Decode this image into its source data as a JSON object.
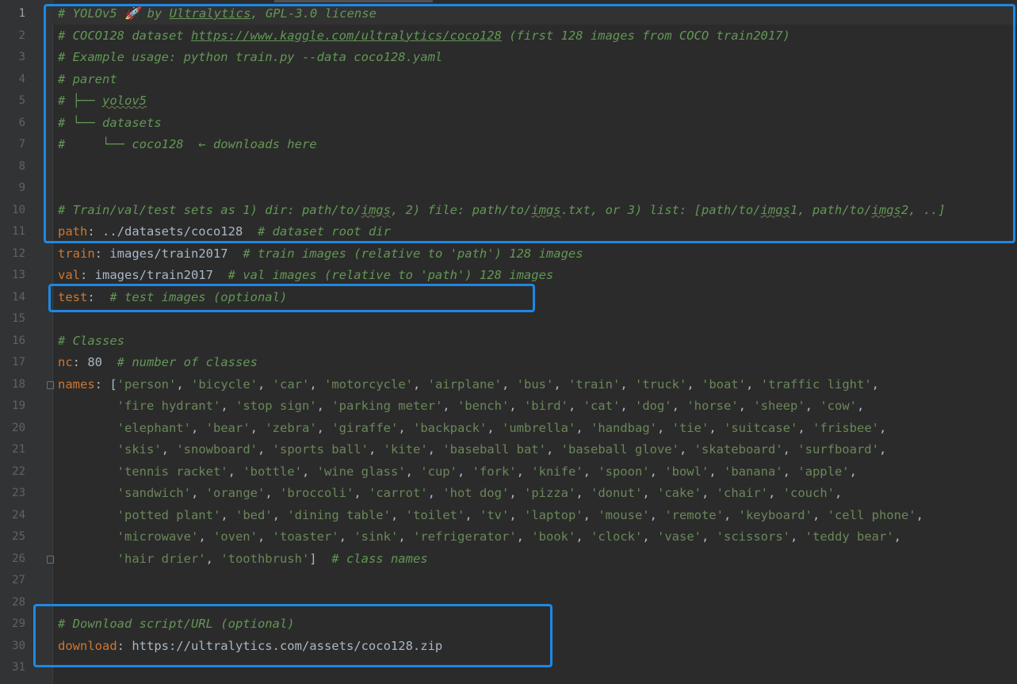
{
  "lines": [
    {
      "n": "1",
      "active": true,
      "parts": [
        {
          "t": "# YOLOv5 🚀 by ",
          "c": "c"
        },
        {
          "t": "Ultralytics",
          "c": "c u"
        },
        {
          "t": ", GPL-3.0 license",
          "c": "c"
        }
      ]
    },
    {
      "n": "2",
      "parts": [
        {
          "t": "# COCO128 dataset ",
          "c": "c"
        },
        {
          "t": "https://www.kaggle.com/ultralytics/coco128",
          "c": "c u"
        },
        {
          "t": " (first 128 images from COCO train2017)",
          "c": "c"
        }
      ]
    },
    {
      "n": "3",
      "parts": [
        {
          "t": "# Example usage: python train.py --data coco128.yaml",
          "c": "c"
        }
      ]
    },
    {
      "n": "4",
      "parts": [
        {
          "t": "# parent",
          "c": "c"
        }
      ]
    },
    {
      "n": "5",
      "parts": [
        {
          "t": "# ├── ",
          "c": "c"
        },
        {
          "t": "yolov5",
          "c": "c w"
        }
      ]
    },
    {
      "n": "6",
      "parts": [
        {
          "t": "# └── datasets",
          "c": "c"
        }
      ]
    },
    {
      "n": "7",
      "parts": [
        {
          "t": "#     └── coco128  ← downloads here",
          "c": "c"
        }
      ]
    },
    {
      "n": "8",
      "parts": []
    },
    {
      "n": "9",
      "parts": []
    },
    {
      "n": "10",
      "parts": [
        {
          "t": "# Train/val/test sets as 1) dir: path/to/",
          "c": "c"
        },
        {
          "t": "imgs",
          "c": "c w"
        },
        {
          "t": ", 2) file: path/to/",
          "c": "c"
        },
        {
          "t": "imgs",
          "c": "c w"
        },
        {
          "t": ".txt, or 3) list: [path/to/",
          "c": "c"
        },
        {
          "t": "imgs",
          "c": "c w"
        },
        {
          "t": "1, path/to/",
          "c": "c"
        },
        {
          "t": "imgs",
          "c": "c w"
        },
        {
          "t": "2, ..]",
          "c": "c"
        }
      ]
    },
    {
      "n": "11",
      "parts": [
        {
          "t": "path",
          "c": "k"
        },
        {
          "t": ": ../datasets/coco128  ",
          "c": "t"
        },
        {
          "t": "# dataset root dir",
          "c": "c"
        }
      ]
    },
    {
      "n": "12",
      "parts": [
        {
          "t": "train",
          "c": "k"
        },
        {
          "t": ": images/train2017  ",
          "c": "t"
        },
        {
          "t": "# train images (relative to 'path') 128 images",
          "c": "c"
        }
      ]
    },
    {
      "n": "13",
      "parts": [
        {
          "t": "val",
          "c": "k"
        },
        {
          "t": ": images/train2017  ",
          "c": "t"
        },
        {
          "t": "# val images (relative to 'path') 128 images",
          "c": "c"
        }
      ]
    },
    {
      "n": "14",
      "parts": [
        {
          "t": "test",
          "c": "k"
        },
        {
          "t": ":  ",
          "c": "t"
        },
        {
          "t": "# test images (optional)",
          "c": "c"
        }
      ]
    },
    {
      "n": "15",
      "parts": []
    },
    {
      "n": "16",
      "parts": [
        {
          "t": "# Classes",
          "c": "c"
        }
      ]
    },
    {
      "n": "17",
      "parts": [
        {
          "t": "nc",
          "c": "k"
        },
        {
          "t": ": 80  ",
          "c": "t"
        },
        {
          "t": "# number of classes",
          "c": "c"
        }
      ]
    },
    {
      "n": "18",
      "fold": true,
      "parts": [
        {
          "t": "names",
          "c": "k"
        },
        {
          "t": ": [",
          "c": "t"
        },
        {
          "t": "'person'",
          "c": "s"
        },
        {
          "t": ", ",
          "c": "t"
        },
        {
          "t": "'bicycle'",
          "c": "s"
        },
        {
          "t": ", ",
          "c": "t"
        },
        {
          "t": "'car'",
          "c": "s"
        },
        {
          "t": ", ",
          "c": "t"
        },
        {
          "t": "'motorcycle'",
          "c": "s"
        },
        {
          "t": ", ",
          "c": "t"
        },
        {
          "t": "'airplane'",
          "c": "s"
        },
        {
          "t": ", ",
          "c": "t"
        },
        {
          "t": "'bus'",
          "c": "s"
        },
        {
          "t": ", ",
          "c": "t"
        },
        {
          "t": "'train'",
          "c": "s"
        },
        {
          "t": ", ",
          "c": "t"
        },
        {
          "t": "'truck'",
          "c": "s"
        },
        {
          "t": ", ",
          "c": "t"
        },
        {
          "t": "'boat'",
          "c": "s"
        },
        {
          "t": ", ",
          "c": "t"
        },
        {
          "t": "'traffic light'",
          "c": "s"
        },
        {
          "t": ",",
          "c": "t"
        }
      ]
    },
    {
      "n": "19",
      "parts": [
        {
          "t": "        ",
          "c": "t"
        },
        {
          "t": "'fire hydrant'",
          "c": "s"
        },
        {
          "t": ", ",
          "c": "t"
        },
        {
          "t": "'stop sign'",
          "c": "s"
        },
        {
          "t": ", ",
          "c": "t"
        },
        {
          "t": "'parking meter'",
          "c": "s"
        },
        {
          "t": ", ",
          "c": "t"
        },
        {
          "t": "'bench'",
          "c": "s"
        },
        {
          "t": ", ",
          "c": "t"
        },
        {
          "t": "'bird'",
          "c": "s"
        },
        {
          "t": ", ",
          "c": "t"
        },
        {
          "t": "'cat'",
          "c": "s"
        },
        {
          "t": ", ",
          "c": "t"
        },
        {
          "t": "'dog'",
          "c": "s"
        },
        {
          "t": ", ",
          "c": "t"
        },
        {
          "t": "'horse'",
          "c": "s"
        },
        {
          "t": ", ",
          "c": "t"
        },
        {
          "t": "'sheep'",
          "c": "s"
        },
        {
          "t": ", ",
          "c": "t"
        },
        {
          "t": "'cow'",
          "c": "s"
        },
        {
          "t": ",",
          "c": "t"
        }
      ]
    },
    {
      "n": "20",
      "parts": [
        {
          "t": "        ",
          "c": "t"
        },
        {
          "t": "'elephant'",
          "c": "s"
        },
        {
          "t": ", ",
          "c": "t"
        },
        {
          "t": "'bear'",
          "c": "s"
        },
        {
          "t": ", ",
          "c": "t"
        },
        {
          "t": "'zebra'",
          "c": "s"
        },
        {
          "t": ", ",
          "c": "t"
        },
        {
          "t": "'giraffe'",
          "c": "s"
        },
        {
          "t": ", ",
          "c": "t"
        },
        {
          "t": "'backpack'",
          "c": "s"
        },
        {
          "t": ", ",
          "c": "t"
        },
        {
          "t": "'umbrella'",
          "c": "s"
        },
        {
          "t": ", ",
          "c": "t"
        },
        {
          "t": "'handbag'",
          "c": "s"
        },
        {
          "t": ", ",
          "c": "t"
        },
        {
          "t": "'tie'",
          "c": "s"
        },
        {
          "t": ", ",
          "c": "t"
        },
        {
          "t": "'suitcase'",
          "c": "s"
        },
        {
          "t": ", ",
          "c": "t"
        },
        {
          "t": "'frisbee'",
          "c": "s"
        },
        {
          "t": ",",
          "c": "t"
        }
      ]
    },
    {
      "n": "21",
      "parts": [
        {
          "t": "        ",
          "c": "t"
        },
        {
          "t": "'skis'",
          "c": "s"
        },
        {
          "t": ", ",
          "c": "t"
        },
        {
          "t": "'snowboard'",
          "c": "s"
        },
        {
          "t": ", ",
          "c": "t"
        },
        {
          "t": "'sports ball'",
          "c": "s"
        },
        {
          "t": ", ",
          "c": "t"
        },
        {
          "t": "'kite'",
          "c": "s"
        },
        {
          "t": ", ",
          "c": "t"
        },
        {
          "t": "'baseball bat'",
          "c": "s"
        },
        {
          "t": ", ",
          "c": "t"
        },
        {
          "t": "'baseball glove'",
          "c": "s"
        },
        {
          "t": ", ",
          "c": "t"
        },
        {
          "t": "'skateboard'",
          "c": "s"
        },
        {
          "t": ", ",
          "c": "t"
        },
        {
          "t": "'surfboard'",
          "c": "s"
        },
        {
          "t": ",",
          "c": "t"
        }
      ]
    },
    {
      "n": "22",
      "parts": [
        {
          "t": "        ",
          "c": "t"
        },
        {
          "t": "'tennis racket'",
          "c": "s"
        },
        {
          "t": ", ",
          "c": "t"
        },
        {
          "t": "'bottle'",
          "c": "s"
        },
        {
          "t": ", ",
          "c": "t"
        },
        {
          "t": "'wine glass'",
          "c": "s"
        },
        {
          "t": ", ",
          "c": "t"
        },
        {
          "t": "'cup'",
          "c": "s"
        },
        {
          "t": ", ",
          "c": "t"
        },
        {
          "t": "'fork'",
          "c": "s"
        },
        {
          "t": ", ",
          "c": "t"
        },
        {
          "t": "'knife'",
          "c": "s"
        },
        {
          "t": ", ",
          "c": "t"
        },
        {
          "t": "'spoon'",
          "c": "s"
        },
        {
          "t": ", ",
          "c": "t"
        },
        {
          "t": "'bowl'",
          "c": "s"
        },
        {
          "t": ", ",
          "c": "t"
        },
        {
          "t": "'banana'",
          "c": "s"
        },
        {
          "t": ", ",
          "c": "t"
        },
        {
          "t": "'apple'",
          "c": "s"
        },
        {
          "t": ",",
          "c": "t"
        }
      ]
    },
    {
      "n": "23",
      "parts": [
        {
          "t": "        ",
          "c": "t"
        },
        {
          "t": "'sandwich'",
          "c": "s"
        },
        {
          "t": ", ",
          "c": "t"
        },
        {
          "t": "'orange'",
          "c": "s"
        },
        {
          "t": ", ",
          "c": "t"
        },
        {
          "t": "'broccoli'",
          "c": "s"
        },
        {
          "t": ", ",
          "c": "t"
        },
        {
          "t": "'carrot'",
          "c": "s"
        },
        {
          "t": ", ",
          "c": "t"
        },
        {
          "t": "'hot dog'",
          "c": "s"
        },
        {
          "t": ", ",
          "c": "t"
        },
        {
          "t": "'pizza'",
          "c": "s"
        },
        {
          "t": ", ",
          "c": "t"
        },
        {
          "t": "'donut'",
          "c": "s"
        },
        {
          "t": ", ",
          "c": "t"
        },
        {
          "t": "'cake'",
          "c": "s"
        },
        {
          "t": ", ",
          "c": "t"
        },
        {
          "t": "'chair'",
          "c": "s"
        },
        {
          "t": ", ",
          "c": "t"
        },
        {
          "t": "'couch'",
          "c": "s"
        },
        {
          "t": ",",
          "c": "t"
        }
      ]
    },
    {
      "n": "24",
      "parts": [
        {
          "t": "        ",
          "c": "t"
        },
        {
          "t": "'potted plant'",
          "c": "s"
        },
        {
          "t": ", ",
          "c": "t"
        },
        {
          "t": "'bed'",
          "c": "s"
        },
        {
          "t": ", ",
          "c": "t"
        },
        {
          "t": "'dining table'",
          "c": "s"
        },
        {
          "t": ", ",
          "c": "t"
        },
        {
          "t": "'toilet'",
          "c": "s"
        },
        {
          "t": ", ",
          "c": "t"
        },
        {
          "t": "'tv'",
          "c": "s"
        },
        {
          "t": ", ",
          "c": "t"
        },
        {
          "t": "'laptop'",
          "c": "s"
        },
        {
          "t": ", ",
          "c": "t"
        },
        {
          "t": "'mouse'",
          "c": "s"
        },
        {
          "t": ", ",
          "c": "t"
        },
        {
          "t": "'remote'",
          "c": "s"
        },
        {
          "t": ", ",
          "c": "t"
        },
        {
          "t": "'keyboard'",
          "c": "s"
        },
        {
          "t": ", ",
          "c": "t"
        },
        {
          "t": "'cell phone'",
          "c": "s"
        },
        {
          "t": ",",
          "c": "t"
        }
      ]
    },
    {
      "n": "25",
      "parts": [
        {
          "t": "        ",
          "c": "t"
        },
        {
          "t": "'microwave'",
          "c": "s"
        },
        {
          "t": ", ",
          "c": "t"
        },
        {
          "t": "'oven'",
          "c": "s"
        },
        {
          "t": ", ",
          "c": "t"
        },
        {
          "t": "'toaster'",
          "c": "s"
        },
        {
          "t": ", ",
          "c": "t"
        },
        {
          "t": "'sink'",
          "c": "s"
        },
        {
          "t": ", ",
          "c": "t"
        },
        {
          "t": "'refrigerator'",
          "c": "s"
        },
        {
          "t": ", ",
          "c": "t"
        },
        {
          "t": "'book'",
          "c": "s"
        },
        {
          "t": ", ",
          "c": "t"
        },
        {
          "t": "'clock'",
          "c": "s"
        },
        {
          "t": ", ",
          "c": "t"
        },
        {
          "t": "'vase'",
          "c": "s"
        },
        {
          "t": ", ",
          "c": "t"
        },
        {
          "t": "'scissors'",
          "c": "s"
        },
        {
          "t": ", ",
          "c": "t"
        },
        {
          "t": "'teddy bear'",
          "c": "s"
        },
        {
          "t": ",",
          "c": "t"
        }
      ]
    },
    {
      "n": "26",
      "fold": true,
      "parts": [
        {
          "t": "        ",
          "c": "t"
        },
        {
          "t": "'hair drier'",
          "c": "s"
        },
        {
          "t": ", ",
          "c": "t"
        },
        {
          "t": "'toothbrush'",
          "c": "s"
        },
        {
          "t": "]  ",
          "c": "t"
        },
        {
          "t": "# class names",
          "c": "c"
        }
      ]
    },
    {
      "n": "27",
      "parts": []
    },
    {
      "n": "28",
      "parts": []
    },
    {
      "n": "29",
      "parts": [
        {
          "t": "# Download script/URL (optional)",
          "c": "c"
        }
      ]
    },
    {
      "n": "30",
      "parts": [
        {
          "t": "download",
          "c": "k"
        },
        {
          "t": ": https://ultralytics.com/assets/coco128.zip",
          "c": "t"
        }
      ]
    },
    {
      "n": "31",
      "parts": []
    }
  ],
  "highlight_color": "#1e88e5",
  "colors": {
    "comment": "#629755",
    "key": "#cc7832",
    "text": "#a9b7c6",
    "string": "#6a8759",
    "background": "#2b2b2b"
  }
}
